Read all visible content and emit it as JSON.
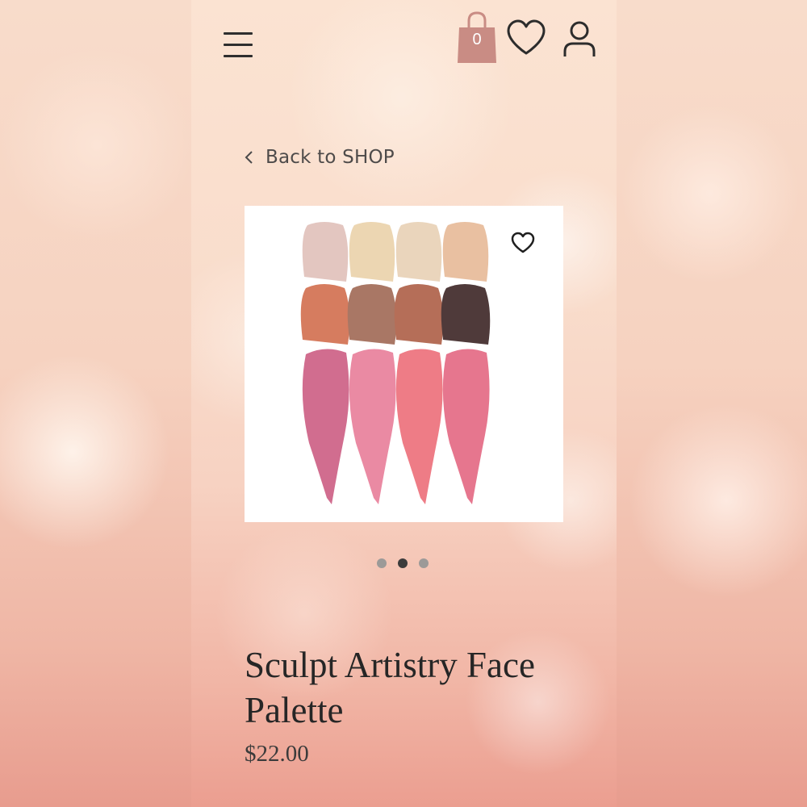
{
  "header": {
    "cart_count": "0",
    "icons": [
      "menu-icon",
      "shopping-bag-icon",
      "heart-icon",
      "user-icon"
    ],
    "bag_color": "#c98c84"
  },
  "nav": {
    "back_label": "Back to SHOP"
  },
  "gallery": {
    "slide_count": 3,
    "active_slide": 2,
    "swatch_colors": [
      "#e3c6c0",
      "#ecd6b2",
      "#ead5bc",
      "#e9c0a1",
      "#d67c5f",
      "#a97765",
      "#b56e58",
      "#4f3a3a",
      "#d16d8f",
      "#ea8aa3",
      "#ee7c86",
      "#e6768e"
    ]
  },
  "product": {
    "title": "Sculpt Artistry Face Palette",
    "price": "$22.00"
  }
}
